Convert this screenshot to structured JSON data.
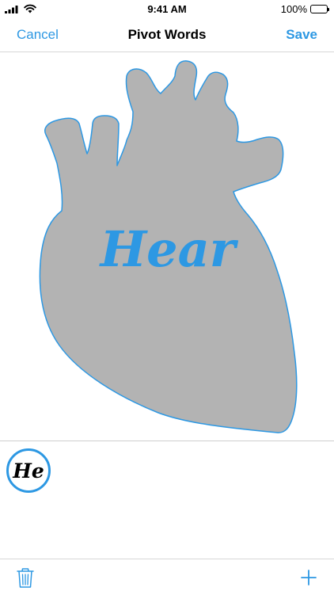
{
  "status_bar": {
    "time": "9:41 AM",
    "battery_percent": "100%",
    "battery_level": 1.0
  },
  "nav": {
    "cancel_label": "Cancel",
    "title": "Pivot Words",
    "save_label": "Save"
  },
  "canvas": {
    "word": "Hear",
    "shape": "heart-icon",
    "fill_color": "#b3b3b3",
    "outline_color": "#2d98e3",
    "word_color": "#2d98e3"
  },
  "tray": {
    "chips": [
      {
        "label": "He"
      }
    ]
  },
  "toolbar": {
    "trash_icon": "trash-icon",
    "add_icon": "plus-icon",
    "accent": "#2d98e3"
  }
}
